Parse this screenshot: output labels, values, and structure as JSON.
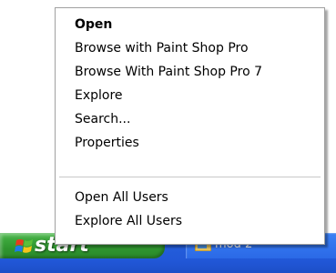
{
  "context_menu": {
    "items": [
      {
        "label": "Open",
        "bold": true
      },
      {
        "label": "Browse with Paint Shop Pro"
      },
      {
        "label": "Browse With Paint Shop Pro 7"
      },
      {
        "label": "Explore"
      },
      {
        "label": "Search..."
      },
      {
        "label": "Properties"
      },
      {
        "label": "Open All Users"
      },
      {
        "label": "Explore All Users"
      }
    ]
  },
  "taskbar": {
    "start_label": "start",
    "task_label": "mod 2",
    "start_logo_icon": "windows-logo-icon",
    "task_icon": "folder-icon"
  }
}
